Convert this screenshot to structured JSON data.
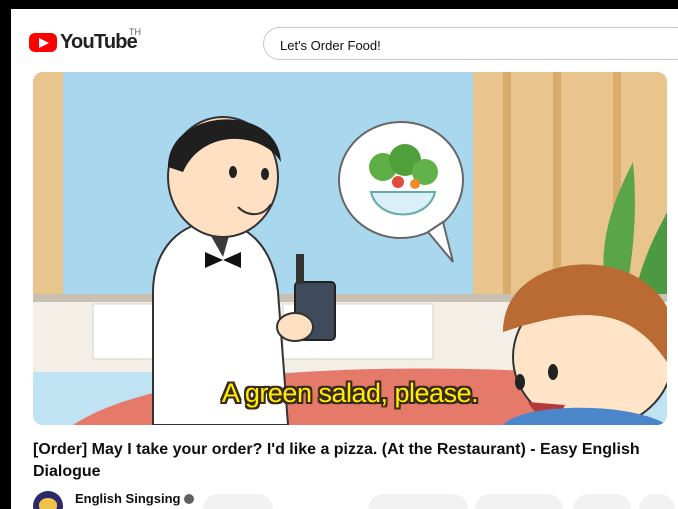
{
  "header": {
    "logo_text": "YouTube",
    "logo_tm": "TH",
    "search_value": "Let's Order Food!"
  },
  "video": {
    "caption": "A green salad, please."
  },
  "video_title": "[Order] May I take your order? I'd like a pizza. (At the Restaurant) - Easy English Dialogue",
  "channel": {
    "name": "English Singsing"
  },
  "colors": {
    "brand_red": "#ff0000",
    "caption_yellow": "#ffee00"
  }
}
